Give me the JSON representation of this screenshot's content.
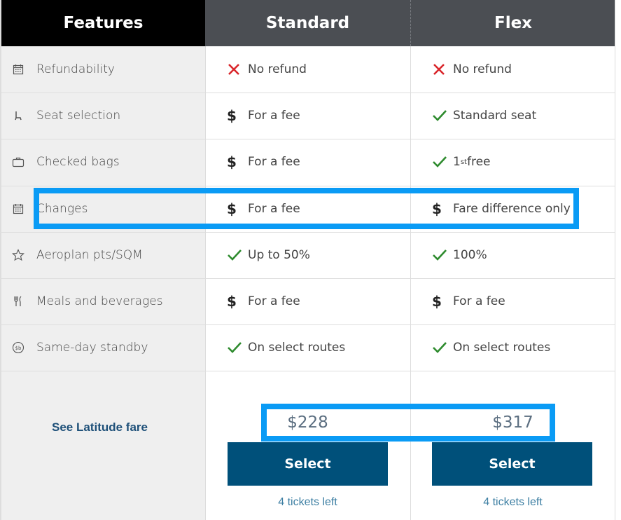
{
  "header": {
    "features": "Features",
    "standard": "Standard",
    "flex": "Flex"
  },
  "rows": [
    {
      "icon": "calendar-icon",
      "label": "Refundability",
      "standard": {
        "mark": "cross",
        "text": "No refund"
      },
      "flex": {
        "mark": "cross",
        "text": "No refund"
      }
    },
    {
      "icon": "seat-icon",
      "label": "Seat selection",
      "standard": {
        "mark": "dollar",
        "text": "For a fee"
      },
      "flex": {
        "mark": "check",
        "text": "Standard seat"
      }
    },
    {
      "icon": "bag-icon",
      "label": "Checked bags",
      "standard": {
        "mark": "dollar",
        "text": "For a fee"
      },
      "flex": {
        "mark": "check",
        "text": "1",
        "sup": "st",
        "text_after": " free"
      }
    },
    {
      "icon": "calendar-icon",
      "label": "Changes",
      "standard": {
        "mark": "dollar",
        "text": "For a fee"
      },
      "flex": {
        "mark": "dollar",
        "text": "Fare difference only"
      }
    },
    {
      "icon": "star-icon",
      "label": "Aeroplan pts/SQM",
      "standard": {
        "mark": "check",
        "text": "Up to 50%"
      },
      "flex": {
        "mark": "check",
        "text": "100%"
      }
    },
    {
      "icon": "fork-knife-icon",
      "label": "Meals and beverages",
      "standard": {
        "mark": "dollar",
        "text": "For a fee"
      },
      "flex": {
        "mark": "dollar",
        "text": "For a fee"
      }
    },
    {
      "icon": "standby-icon",
      "label": "Same-day standby",
      "standard": {
        "mark": "check",
        "text": "On select routes"
      },
      "flex": {
        "mark": "check",
        "text": "On select routes"
      }
    }
  ],
  "footer": {
    "latitude_link": "See Latitude fare",
    "standard": {
      "price": "$228",
      "button": "Select",
      "tickets": "4 tickets left"
    },
    "flex": {
      "price": "$317",
      "button": "Select",
      "tickets": "4 tickets left"
    }
  },
  "colors": {
    "check": "#2e8b2e",
    "cross": "#d9262b",
    "highlight": "#0a9bf5",
    "button": "#00507a"
  }
}
